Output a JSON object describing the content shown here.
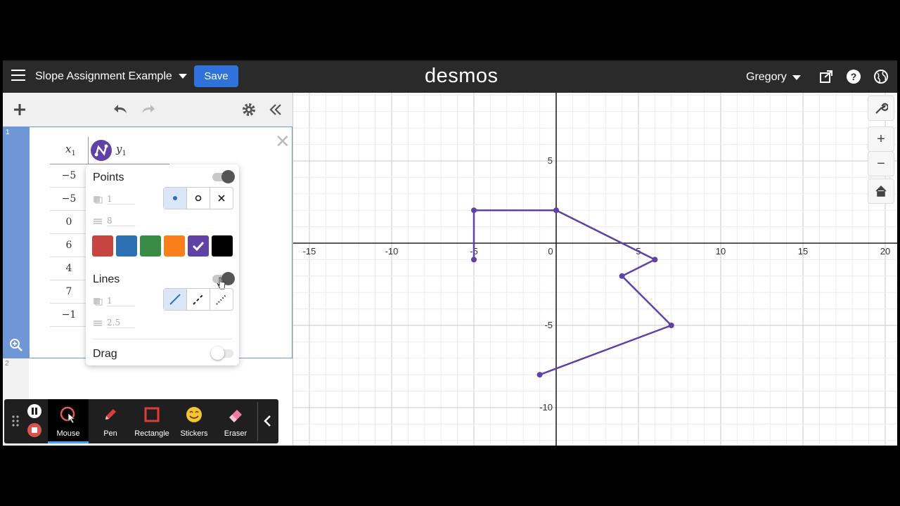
{
  "header": {
    "doc_title": "Slope Assignment Example",
    "save_label": "Save",
    "logo": "desmos",
    "user": "Gregory"
  },
  "expressions": [
    {
      "id": "1",
      "table": {
        "col_x": "x",
        "col_x_sub": "1",
        "col_y": "y",
        "col_y_sub": "1",
        "x_values": [
          "−5",
          "−5",
          "0",
          "6",
          "4",
          "7",
          "−1"
        ]
      }
    },
    {
      "id": "2"
    }
  ],
  "style_popup": {
    "points_label": "Points",
    "points_enabled": true,
    "points_opacity": "1",
    "points_size": "8",
    "lines_label": "Lines",
    "lines_enabled": true,
    "lines_opacity": "1",
    "lines_width": "2.5",
    "drag_label": "Drag",
    "drag_enabled": false,
    "colors": [
      "#c74440",
      "#2d70b3",
      "#388c46",
      "#fa7e19",
      "#6042a6",
      "#000000"
    ],
    "selected_color": "#6042a6"
  },
  "graph": {
    "x_ticks": [
      "-15",
      "-10",
      "-5",
      "0",
      "5",
      "10",
      "15",
      "20"
    ],
    "y_ticks": [
      "5",
      "-5",
      "-10"
    ],
    "series_color": "#6042a6",
    "points": [
      [
        -5,
        -1
      ],
      [
        -5,
        2
      ],
      [
        0,
        2
      ],
      [
        6,
        -1
      ],
      [
        4,
        -2
      ],
      [
        7,
        -5
      ],
      [
        -1,
        -8
      ]
    ]
  },
  "recording_toolbar": {
    "items": [
      {
        "label": "Mouse",
        "icon": "mouse-cursor-icon",
        "active": true
      },
      {
        "label": "Pen",
        "icon": "pen-icon"
      },
      {
        "label": "Rectangle",
        "icon": "rectangle-icon"
      },
      {
        "label": "Stickers",
        "icon": "smiley-icon"
      },
      {
        "label": "Eraser",
        "icon": "eraser-icon"
      }
    ]
  }
}
